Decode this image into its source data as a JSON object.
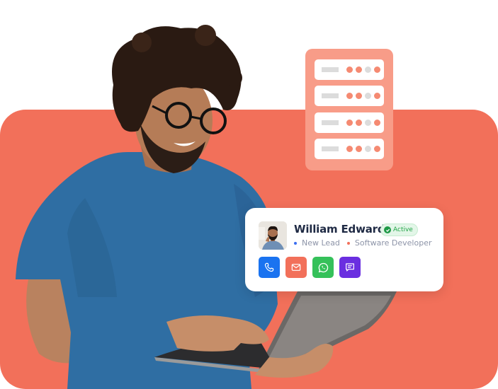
{
  "contact_card": {
    "name": "William Edward.",
    "status": "Active",
    "tags": [
      {
        "label": "New Lead",
        "color": "#3b6df0"
      },
      {
        "label": "Software Developer",
        "color": "#f2705a"
      }
    ],
    "actions": [
      {
        "name": "call",
        "icon": "phone-icon",
        "color": "#1a73f0"
      },
      {
        "name": "email",
        "icon": "mail-icon",
        "color": "#f2705a"
      },
      {
        "name": "whatsapp",
        "icon": "whatsapp-icon",
        "color": "#35c15a"
      },
      {
        "name": "message",
        "icon": "chat-icon",
        "color": "#6a2fe0"
      }
    ]
  },
  "server_graphic": {
    "rows": 4,
    "indicator_lights": [
      "on",
      "on",
      "off",
      "on"
    ]
  },
  "colors": {
    "accent": "#f2705a",
    "server_bg": "#f89c88",
    "shirt": "#2f6ea3"
  }
}
